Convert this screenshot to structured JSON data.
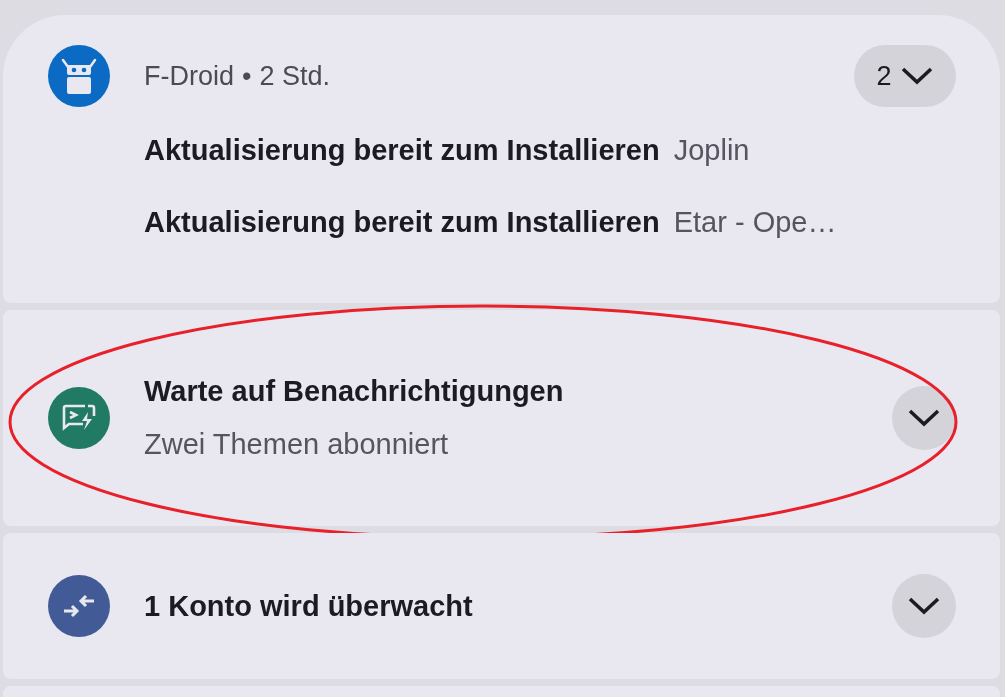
{
  "notifications": [
    {
      "kind": "group",
      "color": "#0b6bc4",
      "app": "F-Droid",
      "separator": "•",
      "time": "2 Std.",
      "count": "2",
      "expanded": false,
      "highlighted": false,
      "lines": [
        {
          "title": "Aktualisierung bereit zum Installieren",
          "text": "Joplin"
        },
        {
          "title": "Aktualisierung bereit zum Installieren",
          "text": "Etar - Ope…"
        }
      ]
    },
    {
      "kind": "single",
      "color": "#217a63",
      "title": "Warte auf Benachrichtigungen",
      "text": "Zwei Themen abonniert",
      "expanded": false,
      "highlighted": true
    },
    {
      "kind": "single",
      "color": "#425b96",
      "title": "1 Konto wird überwacht",
      "expanded": false,
      "highlighted": false
    },
    {
      "kind": "empty"
    }
  ]
}
